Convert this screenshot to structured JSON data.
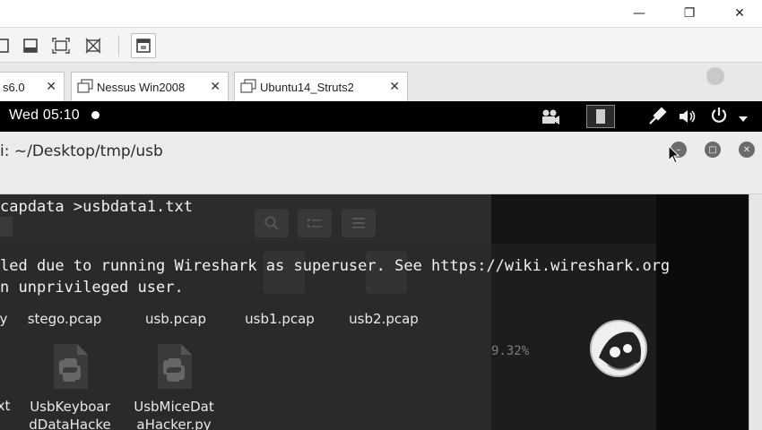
{
  "window_controls": {
    "minimize": "—",
    "restore": "❐",
    "close": "✕"
  },
  "toolbar": {
    "icons": [
      "view-single-icon",
      "view-console-icon",
      "fullscreen-icon",
      "no-scale-icon",
      "unity-icon"
    ]
  },
  "tabs": [
    {
      "label": "s6.0",
      "close": "✕"
    },
    {
      "label": "Nessus Win2008",
      "close": "✕"
    },
    {
      "label": "Ubuntu14_Struts2",
      "close": "✕"
    }
  ],
  "panel": {
    "clock": "Wed 05:10"
  },
  "terminal": {
    "title": "i: ~/Desktop/tmp/usb",
    "lines": [
      "capdata >usbdata1.txt",
      "led due to running Wireshark as superuser. See https://wiki.wireshark.org",
      "n unprivileged user."
    ],
    "progress_fragment": "9.32%"
  },
  "files": [
    {
      "name": "y"
    },
    {
      "name": "stego.pcap"
    },
    {
      "name": "usb.pcap"
    },
    {
      "name": "usb1.pcap"
    },
    {
      "name": "usb2.pcap"
    },
    {
      "name": "xt"
    },
    {
      "name_line1": "UsbKeyboar",
      "name_line2": "dDataHacke"
    },
    {
      "name_line1": "UsbMiceDat",
      "name_line2": "aHacker.py"
    }
  ],
  "colors": {
    "panel": "#000000",
    "terminal_text": "#f2f2f2",
    "desktop": "#151515"
  }
}
